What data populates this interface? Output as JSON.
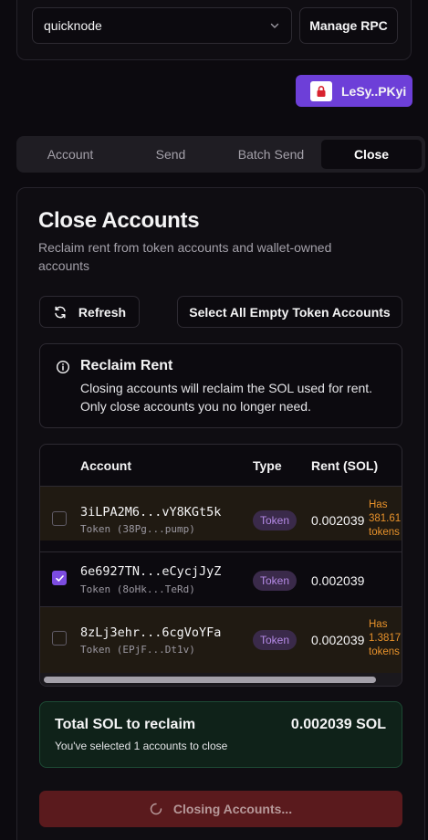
{
  "rpc": {
    "selected": "quicknode",
    "manage_label": "Manage RPC"
  },
  "wallet": {
    "label": "LeSy..PKyi"
  },
  "tabs": [
    {
      "label": "Account",
      "active": false
    },
    {
      "label": "Send",
      "active": false
    },
    {
      "label": "Batch Send",
      "active": false
    },
    {
      "label": "Close",
      "active": true
    }
  ],
  "page": {
    "title": "Close Accounts",
    "subtitle": "Reclaim rent from token accounts and wallet-owned accounts"
  },
  "actions": {
    "refresh_label": "Refresh",
    "select_all_label": "Select All Empty Token Accounts"
  },
  "info": {
    "title": "Reclaim Rent",
    "text": "Closing accounts will reclaim the SOL used for rent. Only close accounts you no longer need."
  },
  "table": {
    "headers": {
      "account": "Account",
      "type": "Type",
      "rent": "Rent (SOL)"
    },
    "rows": [
      {
        "account": "3iLPA2M6...vY8KGt5k",
        "sub": "Token (38Pg...pump)",
        "type": "Token",
        "rent": "0.002039",
        "checked": false,
        "warning_line1": "Has",
        "warning_line2": "381.61",
        "warning_line3": "tokens"
      },
      {
        "account": "6e6927TN...eCycjJyZ",
        "sub": "Token (8oHk...TeRd)",
        "type": "Token",
        "rent": "0.002039",
        "checked": true,
        "warning_line1": "",
        "warning_line2": "",
        "warning_line3": ""
      },
      {
        "account": "8zLj3ehr...6cgVoYFa",
        "sub": "Token (EPjF...Dt1v)",
        "type": "Token",
        "rent": "0.002039",
        "checked": false,
        "warning_line1": "Has",
        "warning_line2": "1.3817",
        "warning_line3": "tokens"
      }
    ]
  },
  "total": {
    "label": "Total SOL to reclaim",
    "value": "0.002039 SOL",
    "note": "You've selected 1 accounts to close"
  },
  "closing_button": {
    "label": "Closing Accounts..."
  },
  "colors": {
    "accent": "#6d3fd8",
    "warning": "#e7912a",
    "danger_bg": "#5a1a1d",
    "success_bg": "#0f2219"
  }
}
